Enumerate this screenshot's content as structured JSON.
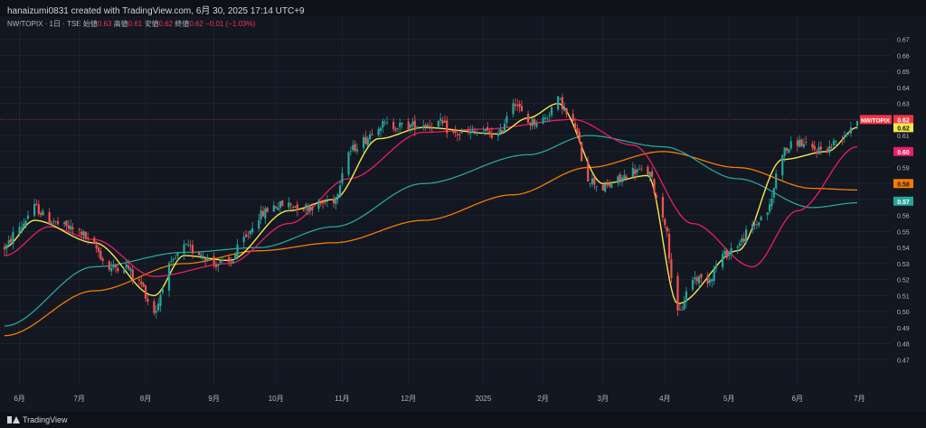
{
  "header": {
    "created_text": "hanaizumi0831 created with TradingView.com, 6月 30, 2025 17:14 UTC+9"
  },
  "legend": {
    "symbol": "NW/TOPIX · 1日 · TSE",
    "open_label": "始値",
    "open": "0.63",
    "high_label": "高値",
    "high": "0.61",
    "low_label": "安値",
    "low": "0.62",
    "close_label": "終値",
    "close": "0.62",
    "change": "−0.01 (−1.03%)"
  },
  "footer": {
    "brand": "TradingView"
  },
  "chart_data": {
    "type": "candlestick",
    "symbol": "NW/TOPIX",
    "y_axis": {
      "ylim": [
        0.46,
        0.68
      ],
      "ticks": [
        "0.67",
        "0.66",
        "0.65",
        "0.64",
        "0.63",
        "0.62",
        "0.61",
        "0.60",
        "0.59",
        "0.58",
        "0.57",
        "0.56",
        "0.55",
        "0.54",
        "0.53",
        "0.52",
        "0.51",
        "0.50",
        "0.49",
        "0.48",
        "0.47"
      ]
    },
    "x_axis": {
      "ticks": [
        "6月",
        "7月",
        "8月",
        "9月",
        "10月",
        "11月",
        "12月",
        "2025",
        "2月",
        "3月",
        "4月",
        "5月",
        "6月",
        "7月"
      ]
    },
    "colors": {
      "up": "#26a69a",
      "down": "#ef5350",
      "ma_fast": "#f5e74b",
      "ma_mid": "#e91e63",
      "ma_slow": "#26a69a",
      "ma_long": "#f57c00",
      "background": "#131722"
    },
    "price_labels": [
      {
        "label": "NW/TOPIX",
        "value": "0.62",
        "color": "#f23645"
      },
      {
        "label": "",
        "value": "0.62",
        "color": "#f5e74b"
      },
      {
        "label": "",
        "value": "0.60",
        "color": "#e91e63"
      },
      {
        "label": "",
        "value": "0.58",
        "color": "#f57c00"
      },
      {
        "label": "",
        "value": "0.57",
        "color": "#26a69a"
      }
    ],
    "price_anchors": [
      [
        "2024-05-27",
        0.54
      ],
      [
        "2024-06-03",
        0.553
      ],
      [
        "2024-06-10",
        0.565
      ],
      [
        "2024-06-17",
        0.557
      ],
      [
        "2024-06-24",
        0.553
      ],
      [
        "2024-07-01",
        0.55
      ],
      [
        "2024-07-08",
        0.54
      ],
      [
        "2024-07-15",
        0.527
      ],
      [
        "2024-07-22",
        0.529
      ],
      [
        "2024-07-29",
        0.518
      ],
      [
        "2024-08-05",
        0.5
      ],
      [
        "2024-08-12",
        0.528
      ],
      [
        "2024-08-19",
        0.54
      ],
      [
        "2024-08-26",
        0.537
      ],
      [
        "2024-09-02",
        0.53
      ],
      [
        "2024-09-09",
        0.53
      ],
      [
        "2024-09-16",
        0.545
      ],
      [
        "2024-09-23",
        0.56
      ],
      [
        "2024-09-30",
        0.566
      ],
      [
        "2024-10-07",
        0.567
      ],
      [
        "2024-10-14",
        0.565
      ],
      [
        "2024-10-21",
        0.567
      ],
      [
        "2024-10-28",
        0.57
      ],
      [
        "2024-11-04",
        0.6
      ],
      [
        "2024-11-11",
        0.607
      ],
      [
        "2024-11-18",
        0.617
      ],
      [
        "2024-11-25",
        0.616
      ],
      [
        "2024-12-02",
        0.616
      ],
      [
        "2024-12-09",
        0.617
      ],
      [
        "2024-12-16",
        0.618
      ],
      [
        "2024-12-23",
        0.611
      ],
      [
        "2025-01-06",
        0.612
      ],
      [
        "2025-01-13",
        0.61
      ],
      [
        "2025-01-20",
        0.632
      ],
      [
        "2025-01-27",
        0.618
      ],
      [
        "2025-02-03",
        0.62
      ],
      [
        "2025-02-10",
        0.632
      ],
      [
        "2025-02-17",
        0.617
      ],
      [
        "2025-02-24",
        0.583
      ],
      [
        "2025-03-03",
        0.577
      ],
      [
        "2025-03-10",
        0.582
      ],
      [
        "2025-03-17",
        0.588
      ],
      [
        "2025-03-24",
        0.587
      ],
      [
        "2025-03-31",
        0.56
      ],
      [
        "2025-04-07",
        0.498
      ],
      [
        "2025-04-14",
        0.521
      ],
      [
        "2025-04-21",
        0.52
      ],
      [
        "2025-04-28",
        0.535
      ],
      [
        "2025-05-05",
        0.542
      ],
      [
        "2025-05-12",
        0.553
      ],
      [
        "2025-05-19",
        0.563
      ],
      [
        "2025-05-26",
        0.6
      ],
      [
        "2025-06-02",
        0.606
      ],
      [
        "2025-06-09",
        0.601
      ],
      [
        "2025-06-16",
        0.602
      ],
      [
        "2025-06-23",
        0.61
      ],
      [
        "2025-06-30",
        0.62
      ]
    ],
    "ma_fast_anchors": [
      [
        "2024-05-27",
        0.54
      ],
      [
        "2024-06-10",
        0.557
      ],
      [
        "2024-07-08",
        0.543
      ],
      [
        "2024-08-05",
        0.51
      ],
      [
        "2024-08-19",
        0.535
      ],
      [
        "2024-09-09",
        0.532
      ],
      [
        "2024-10-07",
        0.563
      ],
      [
        "2024-10-28",
        0.57
      ],
      [
        "2024-11-18",
        0.608
      ],
      [
        "2024-12-09",
        0.615
      ],
      [
        "2025-01-13",
        0.611
      ],
      [
        "2025-01-27",
        0.621
      ],
      [
        "2025-02-10",
        0.63
      ],
      [
        "2025-03-03",
        0.58
      ],
      [
        "2025-03-24",
        0.585
      ],
      [
        "2025-04-07",
        0.505
      ],
      [
        "2025-05-05",
        0.538
      ],
      [
        "2025-05-26",
        0.595
      ],
      [
        "2025-06-16",
        0.6
      ],
      [
        "2025-06-30",
        0.615
      ]
    ],
    "ma_mid_anchors": [
      [
        "2024-05-27",
        0.535
      ],
      [
        "2024-06-17",
        0.553
      ],
      [
        "2024-07-08",
        0.545
      ],
      [
        "2024-08-05",
        0.522
      ],
      [
        "2024-09-09",
        0.53
      ],
      [
        "2024-10-07",
        0.555
      ],
      [
        "2024-11-04",
        0.583
      ],
      [
        "2024-12-09",
        0.612
      ],
      [
        "2025-01-06",
        0.614
      ],
      [
        "2025-02-17",
        0.62
      ],
      [
        "2025-03-17",
        0.604
      ],
      [
        "2025-04-14",
        0.555
      ],
      [
        "2025-05-12",
        0.528
      ],
      [
        "2025-06-02",
        0.563
      ],
      [
        "2025-06-30",
        0.603
      ]
    ],
    "ma_slow_anchors": [
      [
        "2024-05-27",
        0.491
      ],
      [
        "2024-07-08",
        0.528
      ],
      [
        "2024-08-19",
        0.537
      ],
      [
        "2024-09-23",
        0.54
      ],
      [
        "2024-10-28",
        0.553
      ],
      [
        "2024-12-09",
        0.58
      ],
      [
        "2025-01-27",
        0.598
      ],
      [
        "2025-02-24",
        0.61
      ],
      [
        "2025-03-31",
        0.603
      ],
      [
        "2025-05-05",
        0.583
      ],
      [
        "2025-06-09",
        0.565
      ],
      [
        "2025-06-30",
        0.568
      ]
    ],
    "ma_long_anchors": [
      [
        "2024-05-27",
        0.485
      ],
      [
        "2024-07-08",
        0.513
      ],
      [
        "2024-08-19",
        0.53
      ],
      [
        "2024-09-23",
        0.538
      ],
      [
        "2024-10-28",
        0.543
      ],
      [
        "2024-12-09",
        0.557
      ],
      [
        "2025-01-20",
        0.573
      ],
      [
        "2025-02-24",
        0.59
      ],
      [
        "2025-03-31",
        0.6
      ],
      [
        "2025-05-05",
        0.59
      ],
      [
        "2025-06-09",
        0.577
      ],
      [
        "2025-06-30",
        0.576
      ]
    ]
  }
}
